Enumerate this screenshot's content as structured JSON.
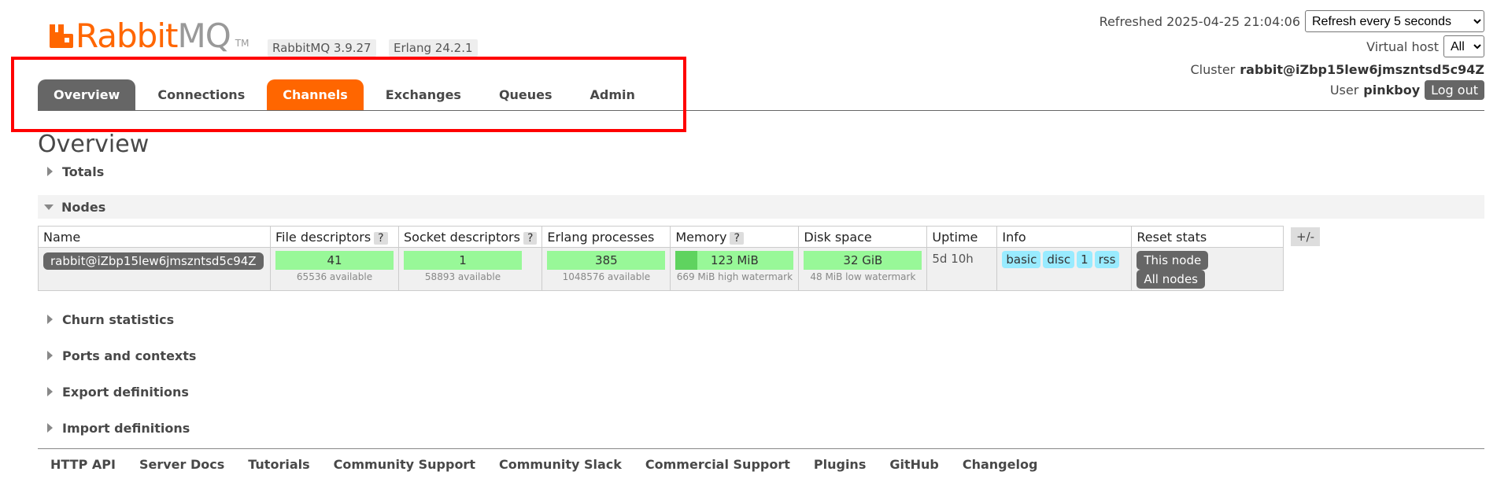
{
  "brand": {
    "logo_text_rabbit": "Rabbit",
    "logo_text_mq": "MQ",
    "logo_tm": "TM",
    "version": "RabbitMQ 3.9.27",
    "erlang": "Erlang 24.2.1",
    "brand_color": "#FF6600"
  },
  "header": {
    "refreshed_label": "Refreshed 2025-04-25 21:04:06",
    "refresh_select_value": "Refresh every 5 seconds",
    "virtual_host_label": "Virtual host",
    "virtual_host_value": "All",
    "cluster_label": "Cluster",
    "cluster_value": "rabbit@iZbp15lew6jmszntsd5c94Z",
    "user_label": "User",
    "user_value": "pinkboy",
    "logout_label": "Log out"
  },
  "tabs": [
    {
      "label": "Overview",
      "state": "selected"
    },
    {
      "label": "Connections",
      "state": "normal"
    },
    {
      "label": "Channels",
      "state": "hover"
    },
    {
      "label": "Exchanges",
      "state": "normal"
    },
    {
      "label": "Queues",
      "state": "normal"
    },
    {
      "label": "Admin",
      "state": "normal"
    }
  ],
  "page_title": "Overview",
  "sections": {
    "totals": "Totals",
    "nodes": "Nodes",
    "churn": "Churn statistics",
    "ports": "Ports and contexts",
    "export": "Export definitions",
    "import": "Import definitions"
  },
  "nodes_table": {
    "headers": {
      "name": "Name",
      "file_desc": "File descriptors",
      "socket_desc": "Socket descriptors",
      "erlang_proc": "Erlang processes",
      "memory": "Memory",
      "disk": "Disk space",
      "uptime": "Uptime",
      "info": "Info",
      "reset": "Reset stats"
    },
    "help_mark": "?",
    "plus_minus": "+/-",
    "row": {
      "name": "rabbit@iZbp15lew6jmszntsd5c94Z",
      "file_desc": "41",
      "file_desc_sub": "65536 available",
      "socket_desc": "1",
      "socket_desc_sub": "58893 available",
      "erlang_proc": "385",
      "erlang_proc_sub": "1048576 available",
      "memory": "123 MiB",
      "memory_sub": "669 MiB high watermark",
      "memory_fraction": 0.184,
      "disk": "32 GiB",
      "disk_sub": "48 MiB low watermark",
      "uptime": "5d 10h",
      "info_tags": [
        "basic",
        "disc",
        "1",
        "rss"
      ],
      "reset_this": "This node",
      "reset_all": "All nodes"
    }
  },
  "footer": [
    "HTTP API",
    "Server Docs",
    "Tutorials",
    "Community Support",
    "Community Slack",
    "Commercial Support",
    "Plugins",
    "GitHub",
    "Changelog"
  ]
}
